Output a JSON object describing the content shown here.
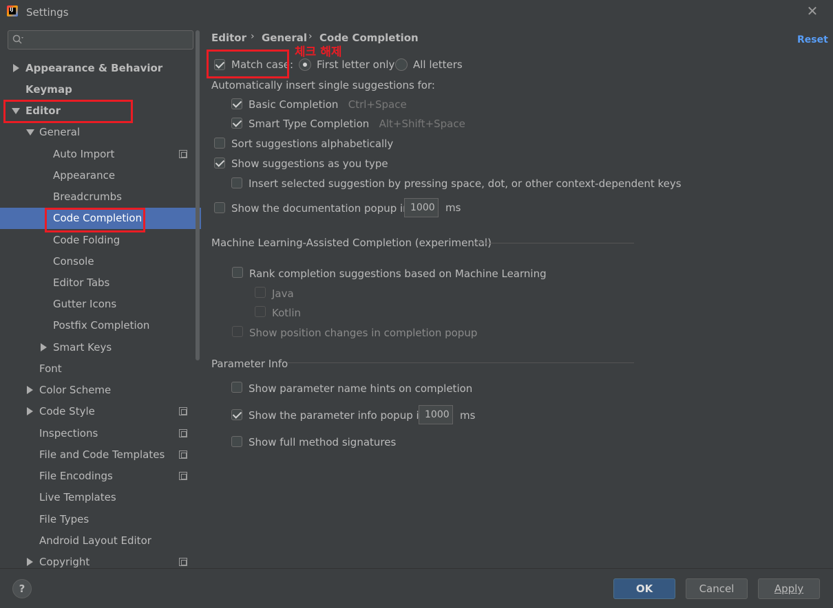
{
  "window": {
    "title": "Settings",
    "close_glyph": "✕"
  },
  "sidebar": {
    "search_placeholder": "",
    "items": [
      {
        "label": "Appearance & Behavior"
      },
      {
        "label": "Keymap"
      },
      {
        "label": "Editor"
      },
      {
        "label": "General"
      },
      {
        "label": "Auto Import"
      },
      {
        "label": "Appearance"
      },
      {
        "label": "Breadcrumbs"
      },
      {
        "label": "Code Completion"
      },
      {
        "label": "Code Folding"
      },
      {
        "label": "Console"
      },
      {
        "label": "Editor Tabs"
      },
      {
        "label": "Gutter Icons"
      },
      {
        "label": "Postfix Completion"
      },
      {
        "label": "Smart Keys"
      },
      {
        "label": "Font"
      },
      {
        "label": "Color Scheme"
      },
      {
        "label": "Code Style"
      },
      {
        "label": "Inspections"
      },
      {
        "label": "File and Code Templates"
      },
      {
        "label": "File Encodings"
      },
      {
        "label": "Live Templates"
      },
      {
        "label": "File Types"
      },
      {
        "label": "Android Layout Editor"
      },
      {
        "label": "Copyright"
      }
    ]
  },
  "breadcrumb": {
    "items": [
      "Editor",
      "General",
      "Code Completion"
    ],
    "separator": "›"
  },
  "reset_label": "Reset",
  "annotation": "체크 해제",
  "options": {
    "match_case": "Match case:",
    "first_letter_only": "First letter only",
    "all_letters": "All letters",
    "auto_insert_header": "Automatically insert single suggestions for:",
    "basic_completion": "Basic Completion",
    "basic_completion_shortcut": "Ctrl+Space",
    "smart_type_completion": "Smart Type Completion",
    "smart_type_shortcut": "Alt+Shift+Space",
    "sort_alphabetically": "Sort suggestions alphabetically",
    "show_as_you_type": "Show suggestions as you type",
    "insert_selected": "Insert selected suggestion by pressing space, dot, or other context-dependent keys",
    "doc_popup": "Show the documentation popup in",
    "doc_popup_value": "1000",
    "doc_popup_unit": "ms"
  },
  "ml_section": {
    "title": "Machine Learning-Assisted Completion (experimental)",
    "rank": "Rank completion suggestions based on Machine Learning",
    "java": "Java",
    "kotlin": "Kotlin",
    "position_changes": "Show position changes in completion popup"
  },
  "param_section": {
    "title": "Parameter Info",
    "name_hints": "Show parameter name hints on completion",
    "info_popup": "Show the parameter info popup in",
    "info_popup_value": "1000",
    "info_popup_unit": "ms",
    "full_signatures": "Show full method signatures"
  },
  "buttons": {
    "help": "?",
    "ok": "OK",
    "cancel": "Cancel",
    "apply": "Apply"
  },
  "colors": {
    "background": "#3c3f41",
    "selection": "#4b6eaf",
    "accent_link": "#589df6",
    "annotation_red": "#ea1c24"
  }
}
